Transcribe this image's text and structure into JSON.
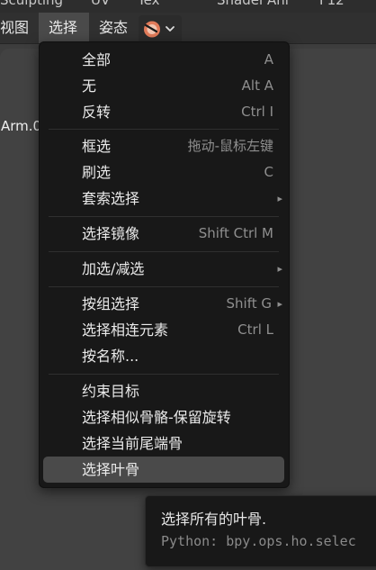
{
  "top_tabs": [
    "Sculpting",
    "UV",
    "Tex",
    "Shader",
    "Ani",
    "F12"
  ],
  "header": {
    "menu": [
      "视图",
      "选择",
      "姿态"
    ],
    "icon": "blender-logo-icon",
    "chevron": "chevron-down-icon"
  },
  "viewport": {
    "object_label": "Arm.0"
  },
  "menu": {
    "items": [
      {
        "label": "全部",
        "shortcut": "A"
      },
      {
        "label": "无",
        "shortcut": "Alt A"
      },
      {
        "label": "反转",
        "shortcut": "Ctrl I"
      },
      {
        "label": "框选",
        "shortcut": "拖动-鼠标左键"
      },
      {
        "label": "刷选",
        "shortcut": "C"
      },
      {
        "label": "套索选择",
        "shortcut": ""
      },
      {
        "label": "选择镜像",
        "shortcut": "Shift Ctrl M"
      },
      {
        "label": "加选/减选",
        "shortcut": ""
      },
      {
        "label": "按组选择",
        "shortcut": "Shift G"
      },
      {
        "label": "选择相连元素",
        "shortcut": "Ctrl L"
      },
      {
        "label": "按名称...",
        "shortcut": ""
      },
      {
        "label": "约束目标",
        "shortcut": ""
      },
      {
        "label": "选择相似骨骼-保留旋转",
        "shortcut": ""
      },
      {
        "label": "选择当前尾端骨",
        "shortcut": ""
      },
      {
        "label": "选择叶骨",
        "shortcut": ""
      }
    ],
    "submenu_arrow": "▸"
  },
  "tooltip": {
    "description": "选择所有的叶骨.",
    "python": "Python: bpy.ops.ho.selec"
  },
  "colors": {
    "menu_bg": "#181818",
    "highlight": "#4a4a4a",
    "header_bg": "#303030"
  }
}
